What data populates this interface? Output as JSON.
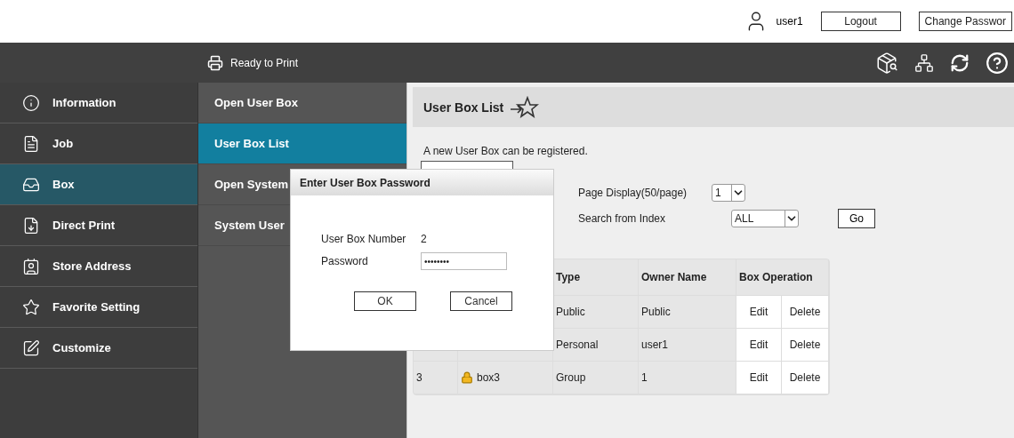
{
  "header": {
    "user": "user1",
    "buttons": [
      "Logout",
      "Change Passwor"
    ]
  },
  "status_bar": {
    "status": "Ready to Print"
  },
  "sidebar": {
    "items": [
      {
        "label": "Information",
        "selected": false
      },
      {
        "label": "Job",
        "selected": false
      },
      {
        "label": "Box",
        "selected": true
      },
      {
        "label": "Direct Print",
        "selected": false
      },
      {
        "label": "Store Address",
        "selected": false
      },
      {
        "label": "Favorite Setting",
        "selected": false
      },
      {
        "label": "Customize",
        "selected": false
      }
    ]
  },
  "submenu": {
    "items": [
      {
        "label": "Open User Box",
        "selected": false
      },
      {
        "label": "User Box List",
        "selected": true
      },
      {
        "label": "Open System",
        "selected": false
      },
      {
        "label": "System User",
        "selected": false
      }
    ]
  },
  "content": {
    "title": "User Box List",
    "notice": "A new User Box can be registered.",
    "page_display": {
      "label": "Page Display(50/page)",
      "value": "1"
    },
    "search_index": {
      "label": "Search from Index",
      "value": "ALL",
      "button": "Go"
    },
    "table": {
      "columns": [
        "Type",
        "Owner Name",
        "Box Operation"
      ],
      "rows": [
        {
          "type": "Public",
          "owner": "Public",
          "actions": [
            "Edit",
            "Delete"
          ]
        },
        {
          "type": "Personal",
          "owner": "user1",
          "actions": [
            "Edit",
            "Delete"
          ]
        },
        {
          "number": "3",
          "name": "box3",
          "locked": true,
          "type": "Group",
          "owner": "1",
          "actions": [
            "Edit",
            "Delete"
          ]
        }
      ]
    }
  },
  "dialog": {
    "title": "Enter User Box Password",
    "fields": [
      {
        "kind": "text",
        "label": "User Box Number",
        "value": "2"
      },
      {
        "kind": "password",
        "label": "Password",
        "value": "••••••••"
      }
    ],
    "buttons": [
      "OK",
      "Cancel"
    ]
  }
}
